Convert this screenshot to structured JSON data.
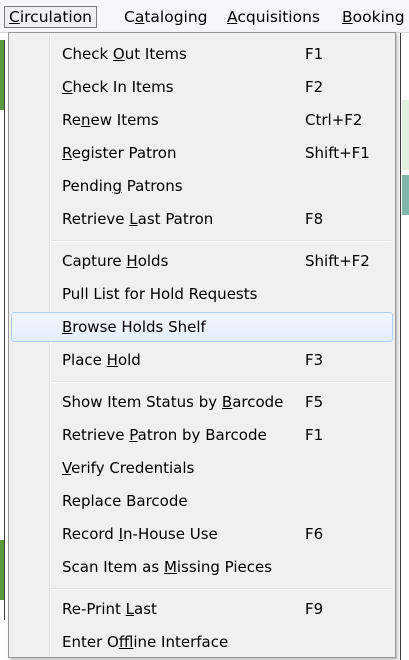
{
  "menubar": {
    "items": [
      {
        "pre": "",
        "u": "C",
        "post": "irculation"
      },
      {
        "pre": "C",
        "u": "a",
        "post": "taloging"
      },
      {
        "pre": "",
        "u": "A",
        "post": "cquisitions"
      },
      {
        "pre": "",
        "u": "B",
        "post": "ooking"
      }
    ]
  },
  "menu": {
    "groups": [
      [
        {
          "pre": "Check ",
          "u": "O",
          "post": "ut Items",
          "shortcut": "F1"
        },
        {
          "pre": "",
          "u": "C",
          "post": "heck In Items",
          "shortcut": "F2"
        },
        {
          "pre": "Re",
          "u": "n",
          "post": "ew Items",
          "shortcut": "Ctrl+F2"
        },
        {
          "pre": "",
          "u": "R",
          "post": "egister Patron",
          "shortcut": "Shift+F1"
        },
        {
          "pre": "Pendin",
          "u": "g",
          "post": " Patrons",
          "shortcut": ""
        },
        {
          "pre": "Retrieve ",
          "u": "L",
          "post": "ast Patron",
          "shortcut": "F8"
        }
      ],
      [
        {
          "pre": "Capture ",
          "u": "H",
          "post": "olds",
          "shortcut": "Shift+F2"
        },
        {
          "pre": "Pull List for Hold Requests",
          "u": "",
          "post": "",
          "shortcut": ""
        },
        {
          "pre": "",
          "u": "B",
          "post": "rowse Holds Shelf",
          "shortcut": "",
          "highlighted": true
        },
        {
          "pre": "Place ",
          "u": "H",
          "post": "old",
          "shortcut": "F3"
        }
      ],
      [
        {
          "pre": "Show Item Status by ",
          "u": "B",
          "post": "arcode",
          "shortcut": "F5"
        },
        {
          "pre": "Retrieve ",
          "u": "P",
          "post": "atron by Barcode",
          "shortcut": "F1"
        },
        {
          "pre": "",
          "u": "V",
          "post": "erify Credentials",
          "shortcut": ""
        },
        {
          "pre": "Replace Barcode",
          "u": "",
          "post": "",
          "shortcut": ""
        },
        {
          "pre": "Record ",
          "u": "I",
          "post": "n-House Use",
          "shortcut": "F6"
        },
        {
          "pre": "Scan Item as ",
          "u": "M",
          "post": "issing Pieces",
          "shortcut": ""
        }
      ],
      [
        {
          "pre": "Re-Print ",
          "u": "L",
          "post": "ast",
          "shortcut": "F9"
        },
        {
          "pre": "Enter O",
          "u": "f",
          "post": "fline Interface",
          "shortcut": ""
        }
      ]
    ]
  }
}
